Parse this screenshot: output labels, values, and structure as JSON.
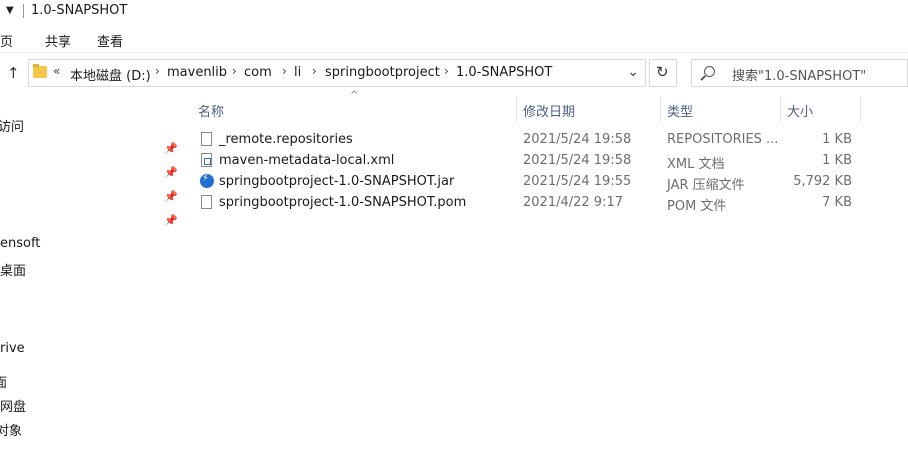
{
  "titlebar": {
    "title": "1.0-SNAPSHOT"
  },
  "ribbon": {
    "tabs": [
      "主页",
      "共享",
      "查看"
    ]
  },
  "address": {
    "back_chevrons": "«",
    "crumbs": [
      "本地磁盘 (D:)",
      "mavenlib",
      "com",
      "li",
      "springbootproject",
      "1.0-SNAPSHOT"
    ]
  },
  "search": {
    "placeholder": "搜索\"1.0-SNAPSHOT\""
  },
  "nav": {
    "items": [
      "访问",
      "ensoft",
      "桌面",
      "rive",
      "面",
      "网盘",
      "对象"
    ]
  },
  "columns": {
    "name": "名称",
    "modified": "修改日期",
    "type": "类型",
    "size": "大小"
  },
  "files": [
    {
      "name": "_remote.repositories",
      "modified": "2021/5/24 19:58",
      "type": "REPOSITORIES ...",
      "size": "1 KB",
      "icon": "file-icon"
    },
    {
      "name": "maven-metadata-local.xml",
      "modified": "2021/5/24 19:58",
      "type": "XML 文档",
      "size": "1 KB",
      "icon": "xml-file-icon"
    },
    {
      "name": "springbootproject-1.0-SNAPSHOT.jar",
      "modified": "2021/5/24 19:55",
      "type": "JAR 压缩文件",
      "size": "5,792 KB",
      "icon": "jar-file-icon"
    },
    {
      "name": "springbootproject-1.0-SNAPSHOT.pom",
      "modified": "2021/4/22 9:17",
      "type": "POM 文件",
      "size": "7 KB",
      "icon": "file-icon"
    }
  ]
}
